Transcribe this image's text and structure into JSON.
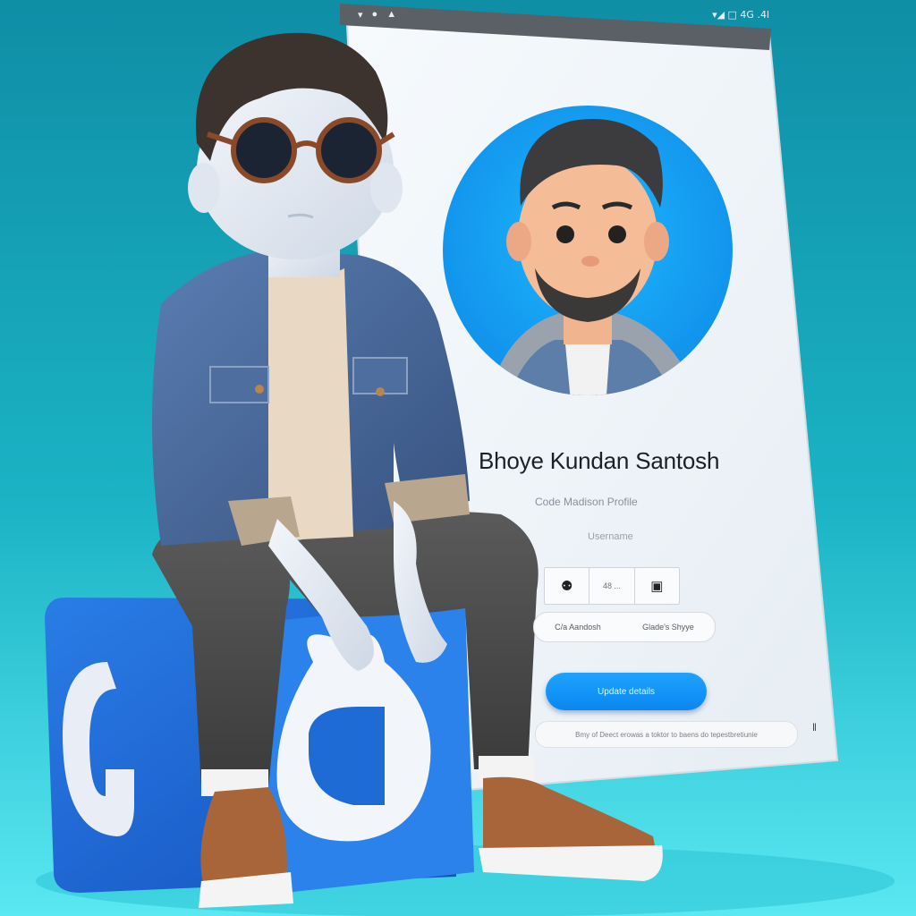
{
  "status_bar": {
    "left_icons": [
      "notification-icon",
      "record-icon",
      "cast-icon"
    ],
    "right_text": "▾◢ □ 4G .4l",
    "right_icons": [
      "wifi-icon",
      "signal-icon",
      "battery-icon"
    ]
  },
  "profile": {
    "name": "Bhoye Kundan Santosh",
    "subtitle": "Code Madison Profile",
    "username": "Username",
    "stats": [
      {
        "icon": "pin-icon",
        "glyph": "⚉",
        "label": ""
      },
      {
        "icon": "stat-icon",
        "glyph": "",
        "label": "48 ..."
      },
      {
        "icon": "bookmark-icon",
        "glyph": "▣",
        "label": ""
      }
    ],
    "chips": [
      "C/a Aandosh",
      "Glade's Shyye"
    ],
    "cta_label": "Update details",
    "footer_text": "Bmy of Deect erowas a toktor to baens do tepestbretiunie",
    "side_glyph": "‖"
  },
  "colors": {
    "bg_top": "#129bb0",
    "bg_bottom": "#52e6f0",
    "cube_blue": "#1f6bd6",
    "avatar_ring": "#14a7ff",
    "cta_blue": "#0f8ff5"
  }
}
